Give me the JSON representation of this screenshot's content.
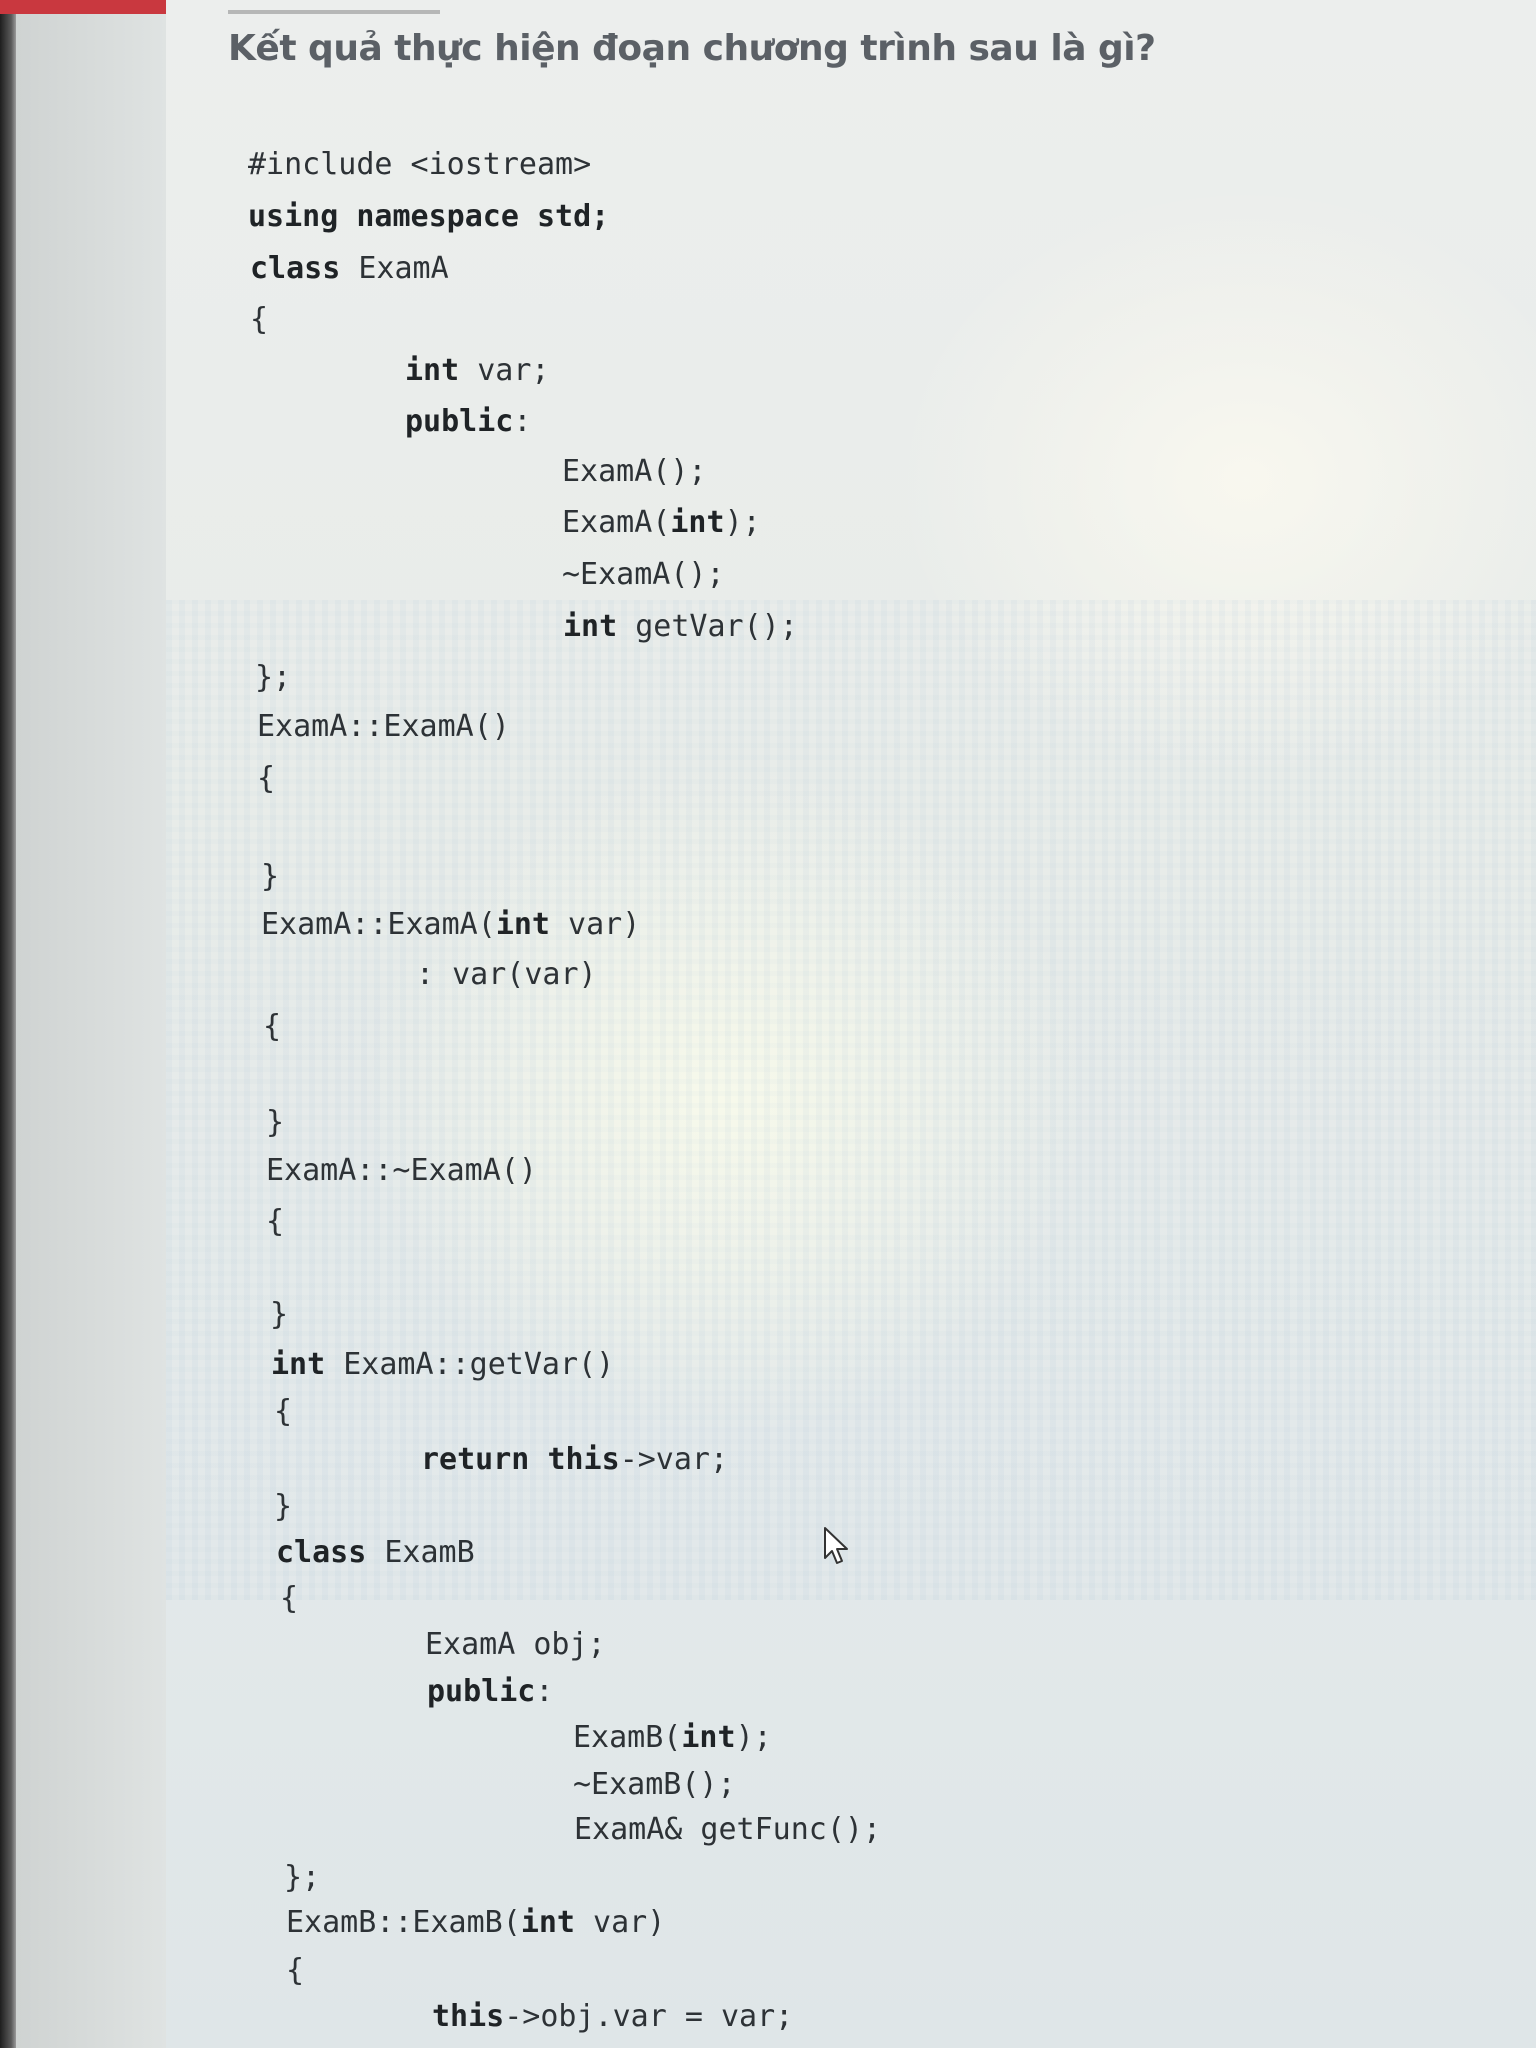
{
  "question": {
    "text": "Kết quả thực hiện đoạn chương trình sau là gì?"
  },
  "code_lines": [
    {
      "parts": [
        {
          "t": "#include <iostream>"
        }
      ]
    },
    {
      "parts": [
        {
          "t": "using namespace std;",
          "kw": true
        }
      ]
    },
    {
      "parts": [
        {
          "t": "class",
          "kw": true
        },
        {
          "t": " ExamA"
        }
      ]
    },
    {
      "parts": [
        {
          "t": "{"
        }
      ]
    },
    {
      "parts": [
        {
          "t": "int",
          "kw": true
        },
        {
          "t": " var;"
        }
      ]
    },
    {
      "parts": [
        {
          "t": "public",
          "kw": true
        },
        {
          "t": ":"
        }
      ]
    },
    {
      "parts": [
        {
          "t": "ExamA();"
        }
      ]
    },
    {
      "parts": [
        {
          "t": "ExamA("
        },
        {
          "t": "int",
          "kw": true
        },
        {
          "t": ");"
        }
      ]
    },
    {
      "parts": [
        {
          "t": "~ExamA();"
        }
      ]
    },
    {
      "parts": [
        {
          "t": "int",
          "kw": true
        },
        {
          "t": " getVar();"
        }
      ]
    },
    {
      "parts": [
        {
          "t": "};"
        }
      ]
    },
    {
      "parts": [
        {
          "t": "ExamA::ExamA()"
        }
      ]
    },
    {
      "parts": [
        {
          "t": "{"
        }
      ]
    },
    {
      "parts": [
        {
          "t": "}"
        }
      ]
    },
    {
      "parts": [
        {
          "t": "ExamA::ExamA("
        },
        {
          "t": "int",
          "kw": true
        },
        {
          "t": " var)"
        }
      ]
    },
    {
      "parts": [
        {
          "t": ": var(var)"
        }
      ]
    },
    {
      "parts": [
        {
          "t": "{"
        }
      ]
    },
    {
      "parts": [
        {
          "t": "}"
        }
      ]
    },
    {
      "parts": [
        {
          "t": "ExamA::~ExamA()"
        }
      ]
    },
    {
      "parts": [
        {
          "t": "{"
        }
      ]
    },
    {
      "parts": [
        {
          "t": "}"
        }
      ]
    },
    {
      "parts": [
        {
          "t": "int",
          "kw": true
        },
        {
          "t": " ExamA::getVar()"
        }
      ]
    },
    {
      "parts": [
        {
          "t": "{"
        }
      ]
    },
    {
      "parts": [
        {
          "t": "return",
          "kw": true
        },
        {
          "t": " "
        },
        {
          "t": "this",
          "kw": true
        },
        {
          "t": "->var;"
        }
      ]
    },
    {
      "parts": [
        {
          "t": "}"
        }
      ]
    },
    {
      "parts": [
        {
          "t": "class",
          "kw": true
        },
        {
          "t": " ExamB"
        }
      ]
    },
    {
      "parts": [
        {
          "t": "{"
        }
      ]
    },
    {
      "parts": [
        {
          "t": "ExamA obj;"
        }
      ]
    },
    {
      "parts": [
        {
          "t": "public",
          "kw": true
        },
        {
          "t": ":"
        }
      ]
    },
    {
      "parts": [
        {
          "t": "ExamB("
        },
        {
          "t": "int",
          "kw": true
        },
        {
          "t": ");"
        }
      ]
    },
    {
      "parts": [
        {
          "t": "~ExamB();"
        }
      ]
    },
    {
      "parts": [
        {
          "t": "ExamA& getFunc();"
        }
      ]
    },
    {
      "parts": [
        {
          "t": "};"
        }
      ]
    },
    {
      "parts": [
        {
          "t": "ExamB::ExamB("
        },
        {
          "t": "int",
          "kw": true
        },
        {
          "t": " var)"
        }
      ]
    },
    {
      "parts": [
        {
          "t": "{"
        }
      ]
    },
    {
      "parts": [
        {
          "t": "this",
          "kw": true
        },
        {
          "t": "->obj.var = var;"
        }
      ]
    }
  ],
  "icons": {
    "cursor": "mouse-pointer-icon"
  }
}
